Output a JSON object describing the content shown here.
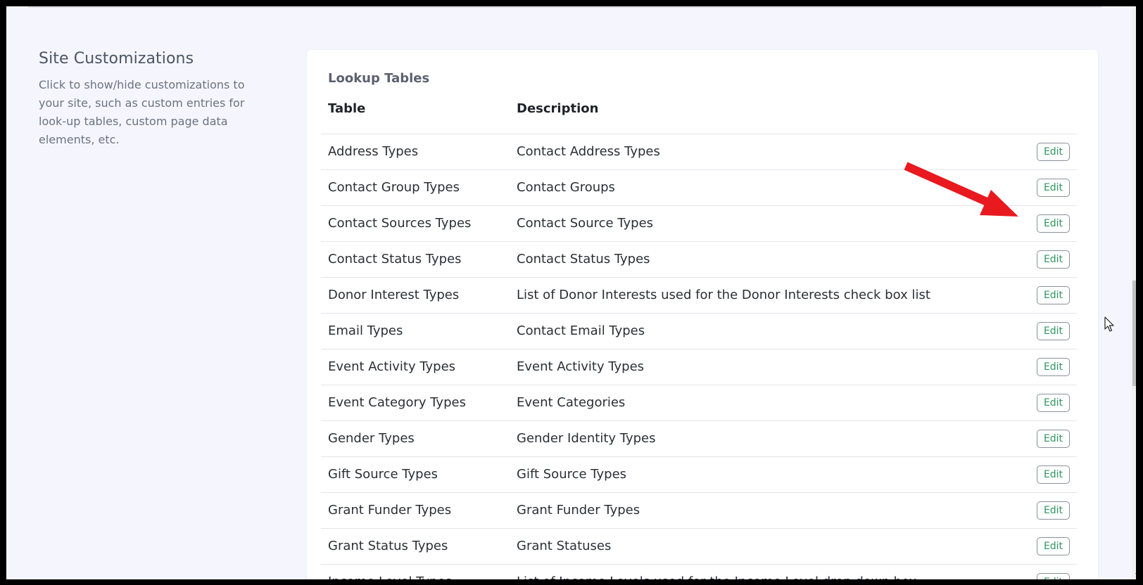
{
  "section": {
    "title": "Site Customizations",
    "description": "Click to show/hide customizations to your site, such as custom entries for look-up tables, custom page data elements, etc."
  },
  "card": {
    "title": "Lookup Tables",
    "columns": {
      "table": "Table",
      "description": "Description"
    }
  },
  "rows": [
    {
      "table": "Address Types",
      "description": "Contact Address Types",
      "action": "Edit"
    },
    {
      "table": "Contact Group Types",
      "description": "Contact Groups",
      "action": "Edit"
    },
    {
      "table": "Contact Sources Types",
      "description": "Contact Source Types",
      "action": "Edit"
    },
    {
      "table": "Contact Status Types",
      "description": "Contact Status Types",
      "action": "Edit"
    },
    {
      "table": "Donor Interest Types",
      "description": "List of Donor Interests used for the Donor Interests check box list",
      "action": "Edit"
    },
    {
      "table": "Email Types",
      "description": "Contact Email Types",
      "action": "Edit"
    },
    {
      "table": "Event Activity Types",
      "description": "Event Activity Types",
      "action": "Edit"
    },
    {
      "table": "Event Category Types",
      "description": "Event Categories",
      "action": "Edit"
    },
    {
      "table": "Gender Types",
      "description": "Gender Identity Types",
      "action": "Edit"
    },
    {
      "table": "Gift Source Types",
      "description": "Gift Source Types",
      "action": "Edit"
    },
    {
      "table": "Grant Funder Types",
      "description": "Grant Funder Types",
      "action": "Edit"
    },
    {
      "table": "Grant Status Types",
      "description": "Grant Statuses",
      "action": "Edit"
    },
    {
      "table": "Income Level Types",
      "description": "List of Income Levels used for the Income Level drop down box",
      "action": "Edit"
    }
  ],
  "annotation": {
    "icon": "red-arrow-icon",
    "color": "#e8191f"
  },
  "colors": {
    "edit_text": "#2f9560",
    "page_bg": "#f5f6fd"
  }
}
